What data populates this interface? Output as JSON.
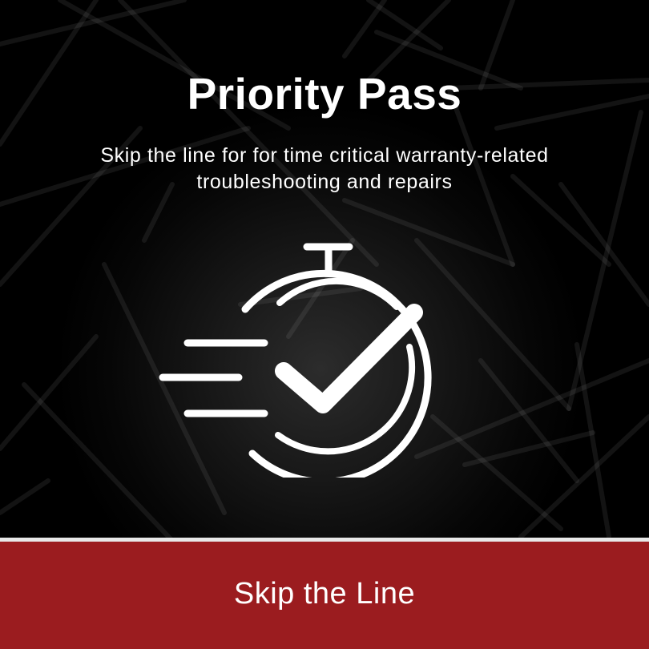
{
  "card": {
    "title": "Priority Pass",
    "subtitle": "Skip the line for for time critical warranty-related troubleshooting and repairs",
    "icon": "fast-stopwatch-check-icon",
    "button_label": "Skip the Line"
  },
  "colors": {
    "background": "#000000",
    "pattern_lines": "#ffffff",
    "text": "#ffffff",
    "button": "#9b1c1f",
    "divider": "#e8e8e8"
  }
}
